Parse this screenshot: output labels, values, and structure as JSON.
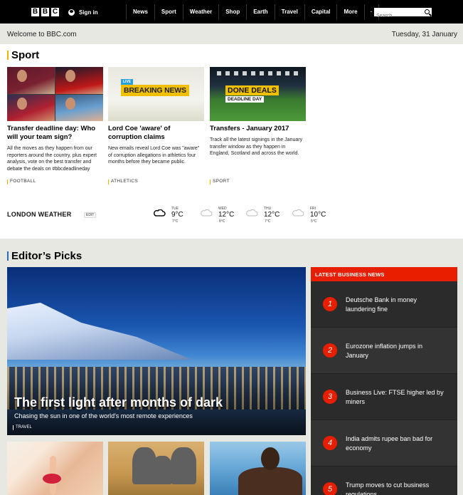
{
  "nav": {
    "logo_letters": [
      "B",
      "B",
      "C"
    ],
    "signin_label": "Sign in",
    "items": [
      "News",
      "Sport",
      "Weather",
      "Shop",
      "Earth",
      "Travel",
      "Capital",
      "More"
    ],
    "more_dots": "·",
    "search_placeholder": "Search"
  },
  "welcome": {
    "message": "Welcome to BBC.com",
    "date": "Tuesday, 31 January"
  },
  "sport": {
    "title": "Sport",
    "cards": [
      {
        "headline": "Transfer deadline day: Who will your team sign?",
        "summary": "All the moves as they happen from our reporters around the country, plus expert analysis, vote on the best transfer and debate the deals on #bbcdeadlineday",
        "tag": "FOOTBALL"
      },
      {
        "image_live": "LIVE",
        "image_banner": "BREAKING NEWS",
        "headline": "Lord Coe 'aware' of corruption claims",
        "summary": "New emails reveal Lord Coe was \"aware\" of corruption allegations in athletics four months before they became public.",
        "tag": "ATHLETICS"
      },
      {
        "image_banner": "DONE DEALS",
        "image_sub": "DEADLINE DAY",
        "headline": "Transfers - January 2017",
        "summary": "Track all the latest signings in the January transfer window as they happen in England, Scotland and across the world.",
        "tag": "SPORT"
      }
    ]
  },
  "weather": {
    "label": "LONDON WEATHER",
    "edit_label": "EDIT",
    "days": [
      {
        "day": "TUE",
        "high": "9°C",
        "low": "7°C",
        "icon": "cloud-icon"
      },
      {
        "day": "WED",
        "high": "12°C",
        "low": "8°C",
        "icon": "cloud-icon"
      },
      {
        "day": "THU",
        "high": "12°C",
        "low": "7°C",
        "icon": "cloud-icon"
      },
      {
        "day": "FRI",
        "high": "10°C",
        "low": "5°C",
        "icon": "cloud-icon"
      }
    ]
  },
  "picks": {
    "title": "Editor’s Picks",
    "hero": {
      "headline": "The first light after months of dark",
      "summary": "Chasing the sun in one of the world's most remote experiences",
      "tag": "TRAVEL"
    }
  },
  "business": {
    "header": "LATEST BUSINESS NEWS",
    "items": [
      {
        "num": "1",
        "text": "Deutsche Bank in money laundering fine"
      },
      {
        "num": "2",
        "text": "Eurozone inflation jumps in January"
      },
      {
        "num": "3",
        "text": "Business Live: FTSE higher led by miners"
      },
      {
        "num": "4",
        "text": "India admits rupee ban bad for economy"
      },
      {
        "num": "5",
        "text": "Trump moves to cut business regulations"
      }
    ]
  },
  "colors": {
    "sport_accent": "#f0b400",
    "picks_accent": "#2a6ebb",
    "business_red": "#e81e00",
    "topbar": "#000000",
    "welcome_bg": "#e8e8e3"
  }
}
